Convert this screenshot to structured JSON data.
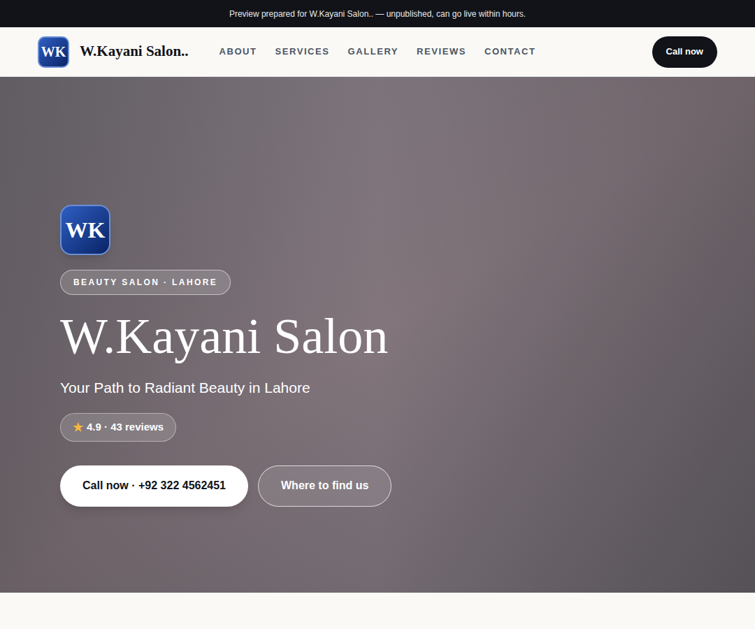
{
  "banner": {
    "text": "Preview prepared for W.Kayani Salon.. — unpublished, can go live within hours."
  },
  "header": {
    "logo": "WK",
    "brand": "W.Kayani Salon..",
    "nav": [
      {
        "label": "ABOUT"
      },
      {
        "label": "SERVICES"
      },
      {
        "label": "GALLERY"
      },
      {
        "label": "REVIEWS"
      },
      {
        "label": "CONTACT"
      }
    ],
    "cta": "Call now"
  },
  "hero": {
    "logo": "WK",
    "badge": "BEAUTY SALON · LAHORE",
    "title": "W.Kayani Salon",
    "subtitle": "Your Path to Radiant Beauty in Lahore",
    "rating": {
      "star": "★",
      "text": "4.9 · 43 reviews"
    },
    "buttons": [
      {
        "label": "Call now · +92 322 4562451",
        "kind": "primary"
      },
      {
        "label": "Where to find us",
        "kind": "outline"
      }
    ]
  }
}
